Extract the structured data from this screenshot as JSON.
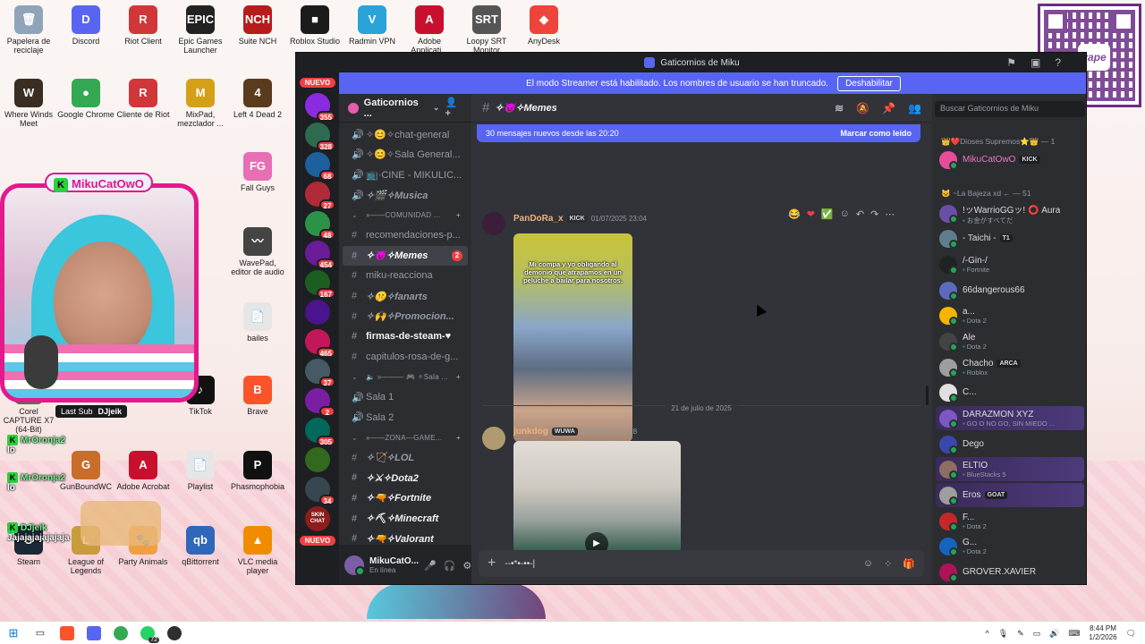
{
  "desktop": {
    "icons": [
      {
        "label": "Papelera de reciclaje",
        "color": "#8fa4b8",
        "glyph": "🗑"
      },
      {
        "label": "Discord",
        "color": "#5865f2",
        "glyph": "D"
      },
      {
        "label": "Riot Client",
        "color": "#d13639",
        "glyph": "R"
      },
      {
        "label": "Epic Games Launcher",
        "color": "#222222",
        "glyph": "EPIC"
      },
      {
        "label": "Suite NCH",
        "color": "#b71c1c",
        "glyph": "NCH"
      },
      {
        "label": "Roblox Studio",
        "color": "#1b1b1b",
        "glyph": "■"
      },
      {
        "label": "Radmin VPN",
        "color": "#2aa4d8",
        "glyph": "V"
      },
      {
        "label": "Adobe Applicati...",
        "color": "#c8102e",
        "glyph": "A"
      },
      {
        "label": "Loopy SRT Monitor",
        "color": "#555555",
        "glyph": "SRT"
      },
      {
        "label": "AnyDesk",
        "color": "#ef443b",
        "glyph": "◆"
      },
      {
        "label": "Where Winds Meet",
        "color": "#3a2d22",
        "glyph": "W"
      },
      {
        "label": "Google Chrome",
        "color": "#34a853",
        "glyph": "●"
      },
      {
        "label": "Cliente de Riot",
        "color": "#d13639",
        "glyph": "R"
      },
      {
        "label": "MixPad, mezclador ...",
        "color": "#d4a017",
        "glyph": "M"
      },
      {
        "label": "Left 4 Dead 2",
        "color": "#5a3b1e",
        "glyph": "4"
      },
      {
        "label": "Fall Guys",
        "color": "#e86fb3",
        "glyph": "FG"
      },
      {
        "label": "WavePad, editor de audio",
        "color": "#444444",
        "glyph": "〰"
      },
      {
        "label": "bailes",
        "color": "#e6e6e6",
        "glyph": "📄"
      },
      {
        "label": "TikTok",
        "color": "#111111",
        "glyph": "♪"
      },
      {
        "label": "Brave",
        "color": "#fb542b",
        "glyph": "B"
      },
      {
        "label": "GunBoundWC",
        "color": "#c86d2a",
        "glyph": "G"
      },
      {
        "label": "Adobe Acrobat",
        "color": "#c8102e",
        "glyph": "A"
      },
      {
        "label": "Playlist",
        "color": "#e6e6e6",
        "glyph": "📄"
      },
      {
        "label": "Phasmophobia",
        "color": "#111111",
        "glyph": "P"
      },
      {
        "label": "Steam",
        "color": "#1b2838",
        "glyph": "S"
      },
      {
        "label": "League of Legends",
        "color": "#c89b3c",
        "glyph": "L"
      },
      {
        "label": "Party Animals",
        "color": "#f0a040",
        "glyph": "🐾"
      },
      {
        "label": "qBittorrent",
        "color": "#2f67ba",
        "glyph": "qb"
      },
      {
        "label": "VLC media player",
        "color": "#f08c00",
        "glyph": "▲"
      },
      {
        "label": "Corel CAPTURE X7 (64-Bit)",
        "color": "#2b8a3e",
        "glyph": "C"
      }
    ]
  },
  "webcam": {
    "streamer_tag": "MikuCatOwO",
    "last_sub_label": "Last Sub",
    "last_sub_name": "DJjeik"
  },
  "chat_overlay": [
    {
      "user": "MrOronja2",
      "text": "lo"
    },
    {
      "user": "MrOronja2",
      "text": "lo"
    },
    {
      "user": "DJjeik",
      "text": "Jajajajajajajaja"
    }
  ],
  "qr": {
    "brand": "yape"
  },
  "discord": {
    "window_title": "Gaticornios de Miku",
    "streamer_banner": "El modo Streamer está habilitado. Los nombres de usuario se han truncado.",
    "disable_label": "Deshabilitar",
    "guilds": [
      {
        "badge": "NUEVO",
        "type": "nuevo"
      },
      {
        "badge": "355",
        "color": "#8a2be2"
      },
      {
        "badge": "328",
        "color": "#2d6a4f"
      },
      {
        "badge": "68",
        "color": "#1e5f9e"
      },
      {
        "badge": "27",
        "color": "#b02a37"
      },
      {
        "badge": "48",
        "color": "#2b9348"
      },
      {
        "badge": "454",
        "color": "#6a1b9a"
      },
      {
        "badge": "167",
        "color": "#1b5e20"
      },
      {
        "badge": "",
        "color": "#4a148c"
      },
      {
        "badge": "465",
        "color": "#c2185b"
      },
      {
        "badge": "37",
        "color": "#455a64"
      },
      {
        "badge": "2",
        "color": "#7b1fa2"
      },
      {
        "badge": "305",
        "color": "#00695c"
      },
      {
        "badge": "",
        "color": "#33691e"
      },
      {
        "badge": "34",
        "color": "#37474f"
      },
      {
        "badge": "SKIN CHAT",
        "color": "#8d1c1c",
        "type": "text"
      },
      {
        "badge": "NUEVO",
        "type": "nuevo"
      }
    ],
    "server_name": "Gaticornios ...",
    "channels": [
      {
        "pre": "🔊",
        "label": "✧😊✧chat-general",
        "kind": "voice"
      },
      {
        "pre": "🔊",
        "label": "✧😊✧Sala General...",
        "kind": "voice"
      },
      {
        "pre": "🔊",
        "label": "📺·CINE - MIKULIC...",
        "kind": "voice"
      },
      {
        "pre": "🔊",
        "label": "✧🎬✧Musica",
        "kind": "voice-it"
      },
      {
        "pre": "",
        "label": "»——COMUNIDAD ...",
        "kind": "cat"
      },
      {
        "pre": "#",
        "label": "recomendaciones-p...",
        "kind": "text"
      },
      {
        "pre": "#",
        "label": "✧😈✧Memes",
        "kind": "active",
        "count": "2"
      },
      {
        "pre": "#",
        "label": "miku-reacciona",
        "kind": "text"
      },
      {
        "pre": "#",
        "label": "✧🤫✧fanarts",
        "kind": "text-it"
      },
      {
        "pre": "#",
        "label": "✧🙌✧Promocion...",
        "kind": "text-it"
      },
      {
        "pre": "#",
        "label": "firmas-de-steam-♥",
        "kind": "bright"
      },
      {
        "pre": "#",
        "label": "capitulos-rosa-de-g...",
        "kind": "text"
      },
      {
        "pre": "",
        "label": "🔈 »——— 🎮 ✧Sala ...",
        "kind": "cat"
      },
      {
        "pre": "🔊",
        "label": "Sala 1",
        "kind": "voice"
      },
      {
        "pre": "🔊",
        "label": "Sala 2",
        "kind": "voice"
      },
      {
        "pre": "",
        "label": "»——ZONA—GAME...",
        "kind": "cat"
      },
      {
        "pre": "#",
        "label": "✧🏹✧LOL",
        "kind": "text-it"
      },
      {
        "pre": "#",
        "label": "✧⚔✧Dota2",
        "kind": "bright-it"
      },
      {
        "pre": "#",
        "label": "✧🔫✧Fortnite",
        "kind": "bright-it"
      },
      {
        "pre": "#",
        "label": "✧⛏✧Minecraft",
        "kind": "bright-it"
      },
      {
        "pre": "#",
        "label": "✧🔫✧Valorant",
        "kind": "bright-it"
      }
    ],
    "user": {
      "name": "MikuCatO...",
      "status": "En línea"
    },
    "channel_title": "✧😈✧Memes",
    "new_messages": "30 mensajes nuevos desde las 20:20",
    "mark_read": "Marcar como leído",
    "messages": [
      {
        "author": "PanDoRa_x",
        "tag": "KICK",
        "time": "01/07/2025 23:04",
        "caption": "Mi compa y yo obligando al demonio que atrapamos en un peluche a bailar para nosotros.",
        "avatar_color": "#3b1f3a"
      },
      {
        "author": "junkdog",
        "tag": "WUWA",
        "time": "21/07/2025 22:28",
        "avatar_color": "#b09a70"
      }
    ],
    "date_divider": "21 de julio de 2025",
    "composer_value": "--•*•-••-|",
    "search_placeholder": "Buscar Gaticornios de Miku",
    "member_groups": [
      {
        "label": "👑❤️Dioses Supremos⭐👑 — 1"
      },
      {
        "label": "🐱 ~La Bajeza xd ← — 51"
      }
    ],
    "members": [
      {
        "name": "MikuCatOwO",
        "badge": "KICK",
        "status": "",
        "color": "#e84d9a",
        "pink": true
      },
      {
        "name": "!ッWarrioGGッ! ⭕ Aura",
        "badge": "",
        "status": "お金がすべてだ",
        "color": "#6b4ea7"
      },
      {
        "name": "- Taichi -",
        "badge": "T1",
        "status": "",
        "color": "#607d8b"
      },
      {
        "name": "/-Gin-/",
        "badge": "",
        "status": "Fortnite",
        "color": "#222222"
      },
      {
        "name": "66dangerous66",
        "badge": "",
        "status": "",
        "color": "#5c6bc0"
      },
      {
        "name": "a...",
        "badge": "",
        "status": "Dota 2",
        "color": "#f4b400"
      },
      {
        "name": "Ale",
        "badge": "",
        "status": "Dota 2",
        "color": "#444444"
      },
      {
        "name": "Chacho",
        "badge": "ARCA",
        "status": "Roblox",
        "color": "#9e9e9e"
      },
      {
        "name": "C...",
        "badge": "",
        "status": "",
        "color": "#e0e0e0"
      },
      {
        "name": "DARAZMON XYZ",
        "badge": "",
        "status": "GO O NO GO, SIN MIEDO ...",
        "color": "#7e57c2",
        "hl": true
      },
      {
        "name": "Dego",
        "badge": "",
        "status": "",
        "color": "#3949ab"
      },
      {
        "name": "ELTIO",
        "badge": "",
        "status": "BlueStacks 5",
        "color": "#8d6e63",
        "hl": true
      },
      {
        "name": "Eros",
        "badge": "GOAT",
        "status": "",
        "color": "#9e9e9e",
        "hl": true
      },
      {
        "name": "F...",
        "badge": "",
        "status": "Dota 2",
        "color": "#c62828"
      },
      {
        "name": "G...",
        "badge": "",
        "status": "Dota 2",
        "color": "#1565c0"
      },
      {
        "name": "GROVER.XAVIER",
        "badge": "",
        "status": "",
        "color": "#ad1457"
      }
    ]
  },
  "taskbar": {
    "clock_time": "8:44 PM",
    "clock_date": "1/2/2026",
    "whatsapp_badge": "72"
  }
}
